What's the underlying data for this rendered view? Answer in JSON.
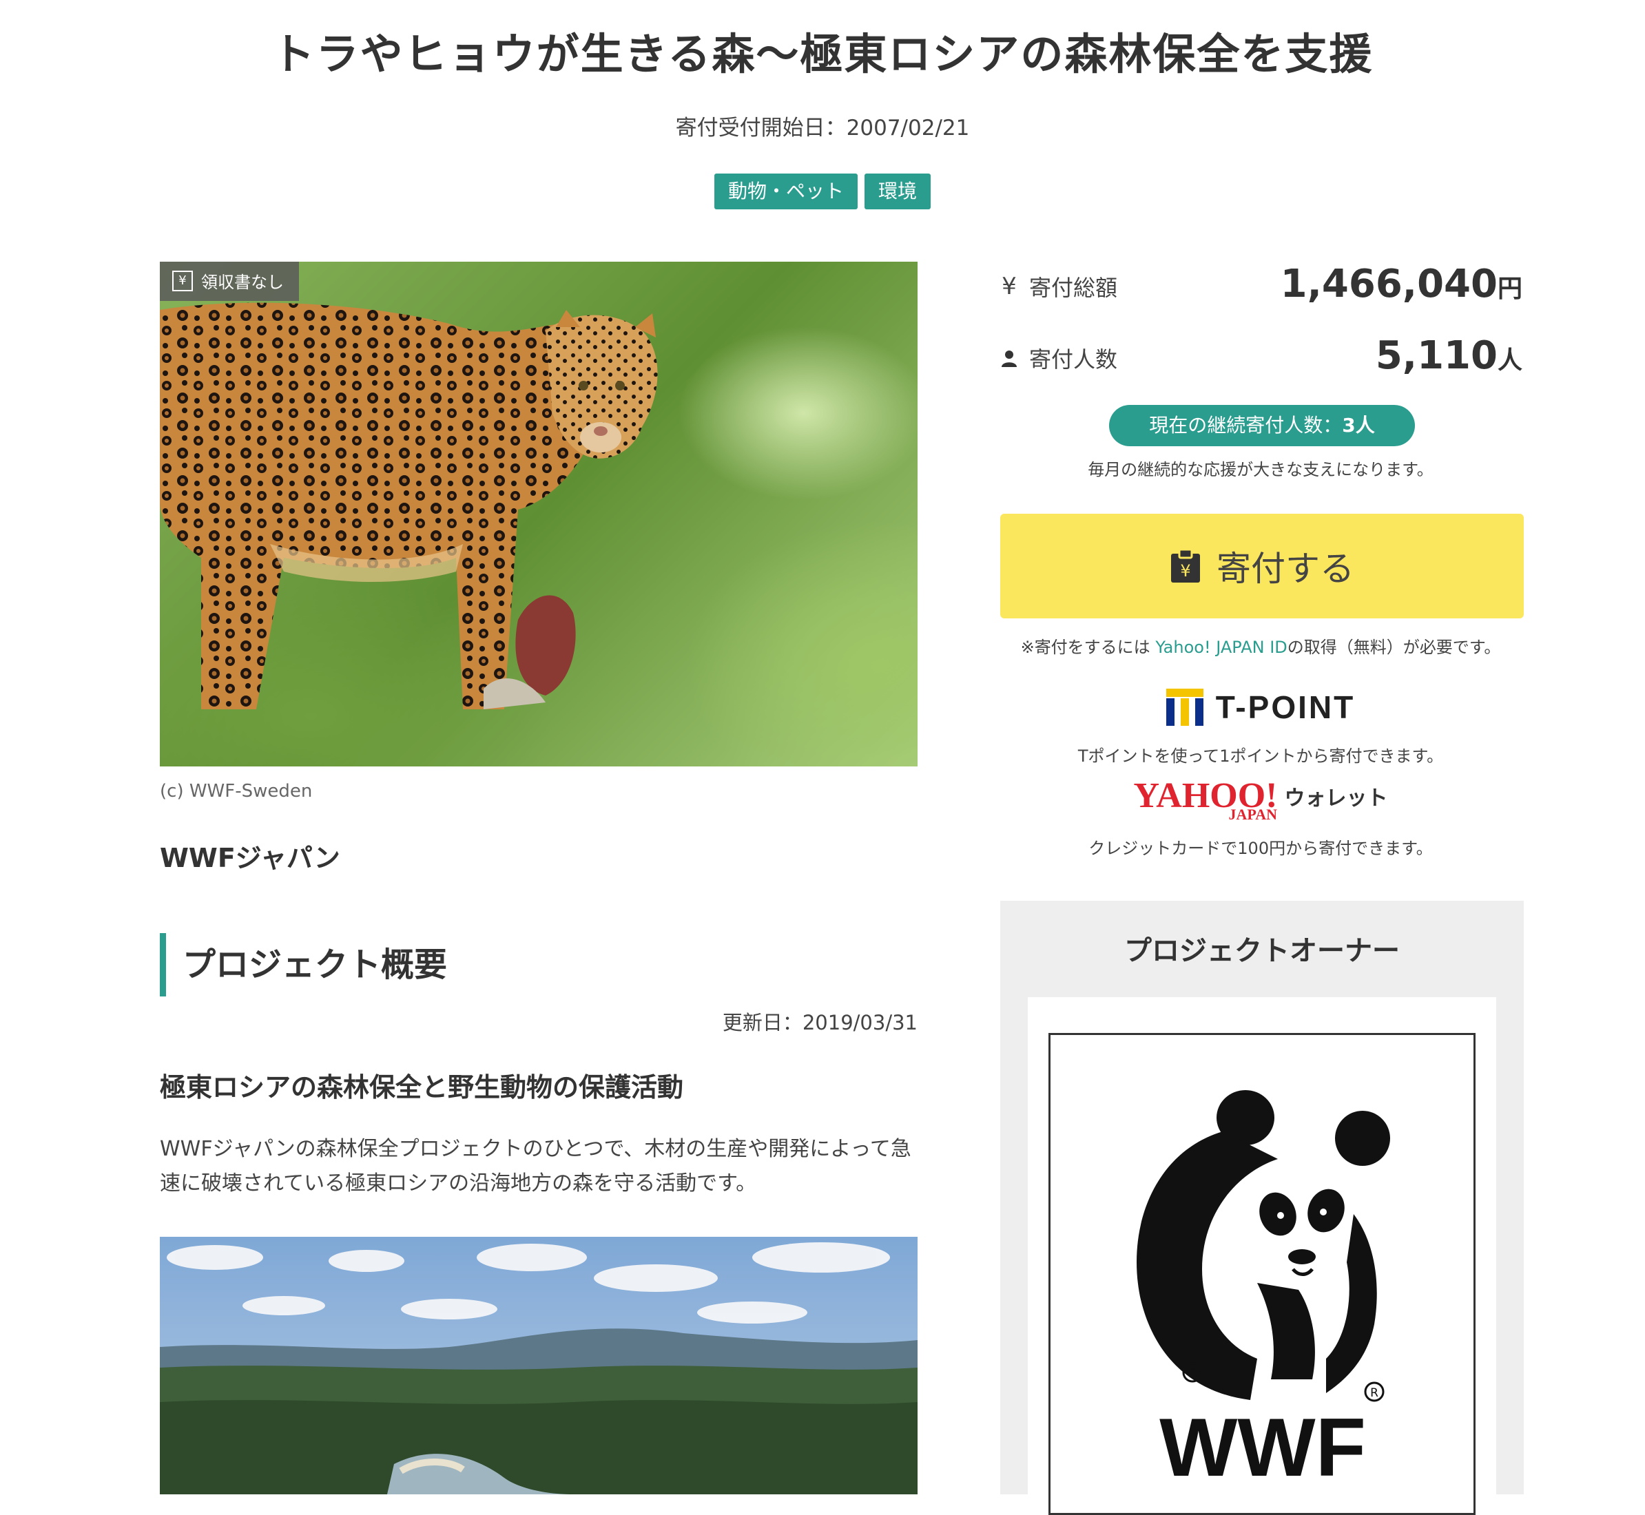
{
  "project": {
    "title": "トラやヒョウが生きる森〜極東ロシアの森林保全を支援",
    "start_date": "寄付受付開始日：2007/02/21",
    "tags": [
      "動物・ペット",
      "環境"
    ]
  },
  "hero": {
    "receipt_badge": "領収書なし",
    "receipt_icon": "¥",
    "credit": "(c) WWF-Sweden"
  },
  "organization": "WWFジャパン",
  "overview": {
    "heading": "プロジェクト概要",
    "updated": "更新日：2019/03/31",
    "subheading": "極東ロシアの森林保全と野生動物の保護活動",
    "body": "WWFジャパンの森林保全プロジェクトのひとつで、木材の生産や開発によって急速に破壊されている極東ロシアの沿海地方の森を守る活動です。"
  },
  "stats": {
    "total_label": "寄付総額",
    "total_value": "1,466,040",
    "total_unit": "円",
    "donors_label": "寄付人数",
    "donors_value": "5,110",
    "donors_unit": "人",
    "recurring_prefix": "現在の継続寄付人数：",
    "recurring_value": "3人",
    "recurring_note": "毎月の継続的な応援が大きな支えになります。"
  },
  "donate": {
    "button_label": "寄付する",
    "notice_prefix": "※寄付をするには ",
    "notice_link": "Yahoo! JAPAN ID",
    "notice_suffix": "の取得（無料）が必要です。"
  },
  "payment": {
    "tpoint_logo": "T-POINT",
    "tpoint_note": "Tポイントを使って1ポイントから寄付できます。",
    "yahoo_logo": "YAHOO!",
    "yahoo_logo_sub": "JAPAN",
    "wallet_label": "ウォレット",
    "yahoo_note": "クレジットカードで100円から寄付できます。"
  },
  "owner": {
    "heading": "プロジェクトオーナー",
    "logo_text": "WWF"
  },
  "colors": {
    "accent": "#2a9d8f",
    "donate_button": "#fbe75e",
    "yahoo_red": "#e0242f"
  }
}
